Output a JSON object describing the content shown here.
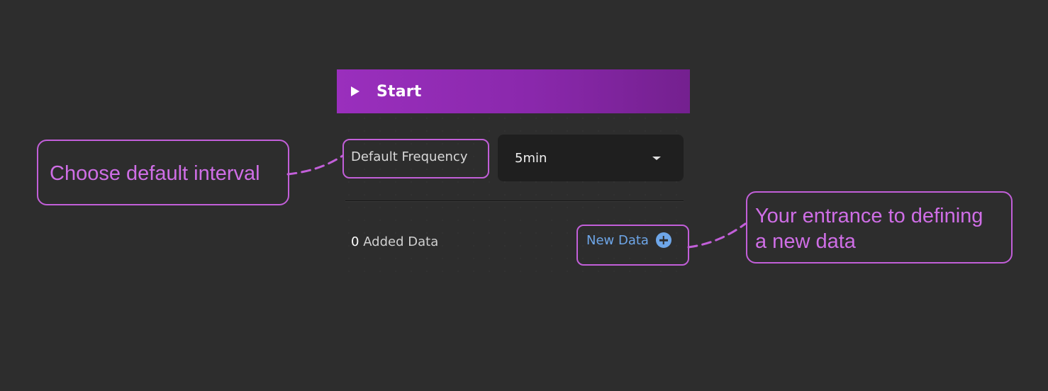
{
  "panel": {
    "header_title": "Start",
    "frequency_label": "Default Frequency",
    "frequency_value": "5min",
    "added_count": "0",
    "added_label": "Added Data",
    "new_data_label": "New Data"
  },
  "annotations": {
    "left_text": "Choose default interval",
    "right_line1": "Your entrance to defining",
    "right_line2": "a new data"
  },
  "colors": {
    "background": "#2d2d2d",
    "header_gradient_start": "#9a2fbd",
    "header_gradient_end": "#74208f",
    "link_blue": "#6ea6e8",
    "annotation_purple": "#c25fd9"
  },
  "icons": {
    "header": "play-triangle-icon",
    "select": "caret-down-icon",
    "new_data": "plus-circle-icon"
  }
}
